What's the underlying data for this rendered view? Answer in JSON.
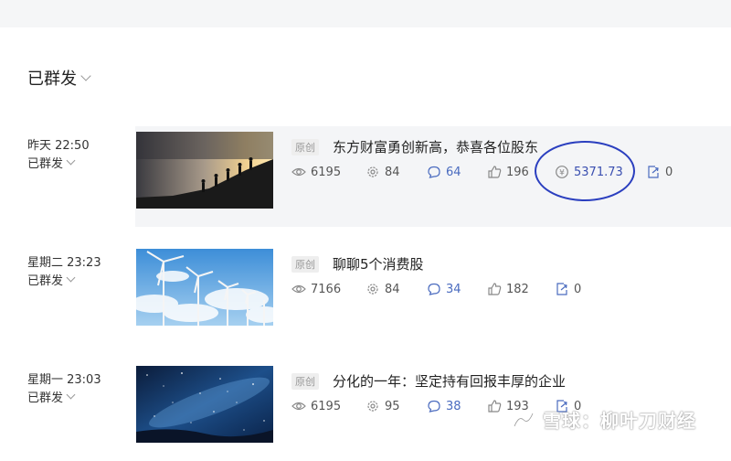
{
  "header": {
    "section_title": "已群发"
  },
  "posts": [
    {
      "time": "昨天 22:50",
      "status": "已群发",
      "tag": "原创",
      "title": "东方财富勇创新高，恭喜各位股东",
      "views": "6195",
      "shares": "84",
      "comments": "64",
      "likes": "196",
      "reward": "5371.73",
      "forwards": "0"
    },
    {
      "time": "星期二 23:23",
      "status": "已群发",
      "tag": "原创",
      "title": "聊聊5个消费股",
      "views": "7166",
      "shares": "84",
      "comments": "34",
      "likes": "182",
      "forwards": "0"
    },
    {
      "time": "星期一 23:03",
      "status": "已群发",
      "tag": "原创",
      "title": "分化的一年：坚定持有回报丰厚的企业",
      "views": "6195",
      "shares": "95",
      "comments": "38",
      "likes": "193",
      "forwards": "0"
    }
  ],
  "watermark": {
    "text": "雪球：柳叶刀财经"
  },
  "colors": {
    "annotation_circle": "#2b3fbf",
    "highlight_bg": "#f4f5f7"
  }
}
